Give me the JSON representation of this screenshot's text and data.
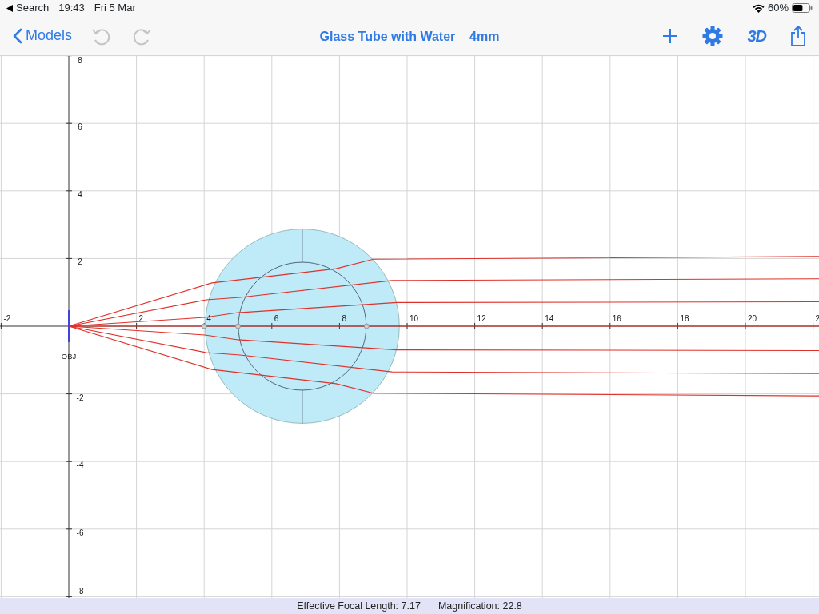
{
  "status_bar": {
    "back_app": "Search",
    "time": "19:43",
    "date": "Fri 5 Mar",
    "battery_text": "60%",
    "battery": {
      "level": 0.6
    }
  },
  "nav_bar": {
    "back": "Models",
    "undo": {
      "disabled": true
    },
    "redo": {
      "disabled": true
    },
    "title": "Glass Tube with Water _ 4mm",
    "view_3d": "3D"
  },
  "plot": {
    "x_ticks": [
      "-2",
      "2",
      "4",
      "6",
      "8",
      "10",
      "12",
      "14",
      "16",
      "18",
      "20",
      "2"
    ],
    "y_ticks": [
      "8",
      "6",
      "4",
      "2",
      "-2",
      "-4",
      "-6",
      "-8"
    ],
    "object_label": "OBJ"
  },
  "footer": {
    "focal_length": "Effective Focal Length: 7.17",
    "magnification": "Magnification: 22.8"
  }
}
